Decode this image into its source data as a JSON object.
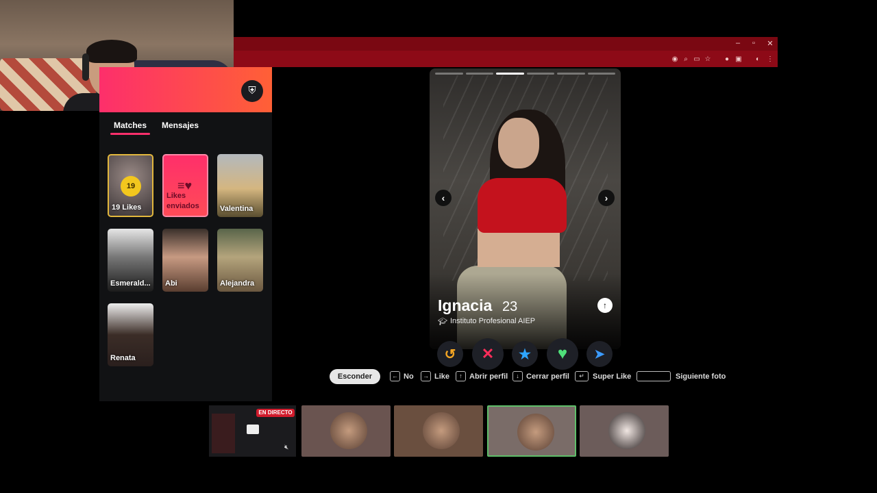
{
  "sidebar": {
    "tabs": [
      "Matches",
      "Mensajes"
    ],
    "likes_count": "19",
    "likes_label": "19 Likes",
    "sent_label": "Likes enviados",
    "matches": [
      {
        "name": "Valentina"
      },
      {
        "name": "Esmerald..."
      },
      {
        "name": "Abi"
      },
      {
        "name": "Alejandra"
      },
      {
        "name": "Renata"
      }
    ]
  },
  "profile": {
    "name": "Ignacia",
    "age": "23",
    "school": "Instituto Profesional AIEP",
    "photo_count": 6,
    "active_photo": 3
  },
  "actions": {
    "rewind": "↺",
    "nope": "✕",
    "super_like": "★",
    "like": "♥",
    "boost": "➤"
  },
  "hints": {
    "hide": "Esconder",
    "no": "No",
    "like": "Like",
    "open": "Abrir perfil",
    "close": "Cerrar perfil",
    "super": "Super Like",
    "next": "Siguiente foto"
  },
  "stream": {
    "live_label": "EN DIRECTO"
  },
  "colors": {
    "brand": "#fd2f6b",
    "browser_bar": "#8d0a17",
    "nope": "#ff2d5a",
    "super": "#2ea6ff",
    "like": "#4fe07a",
    "rewind": "#f5a623",
    "boost": "#3b9bff"
  }
}
